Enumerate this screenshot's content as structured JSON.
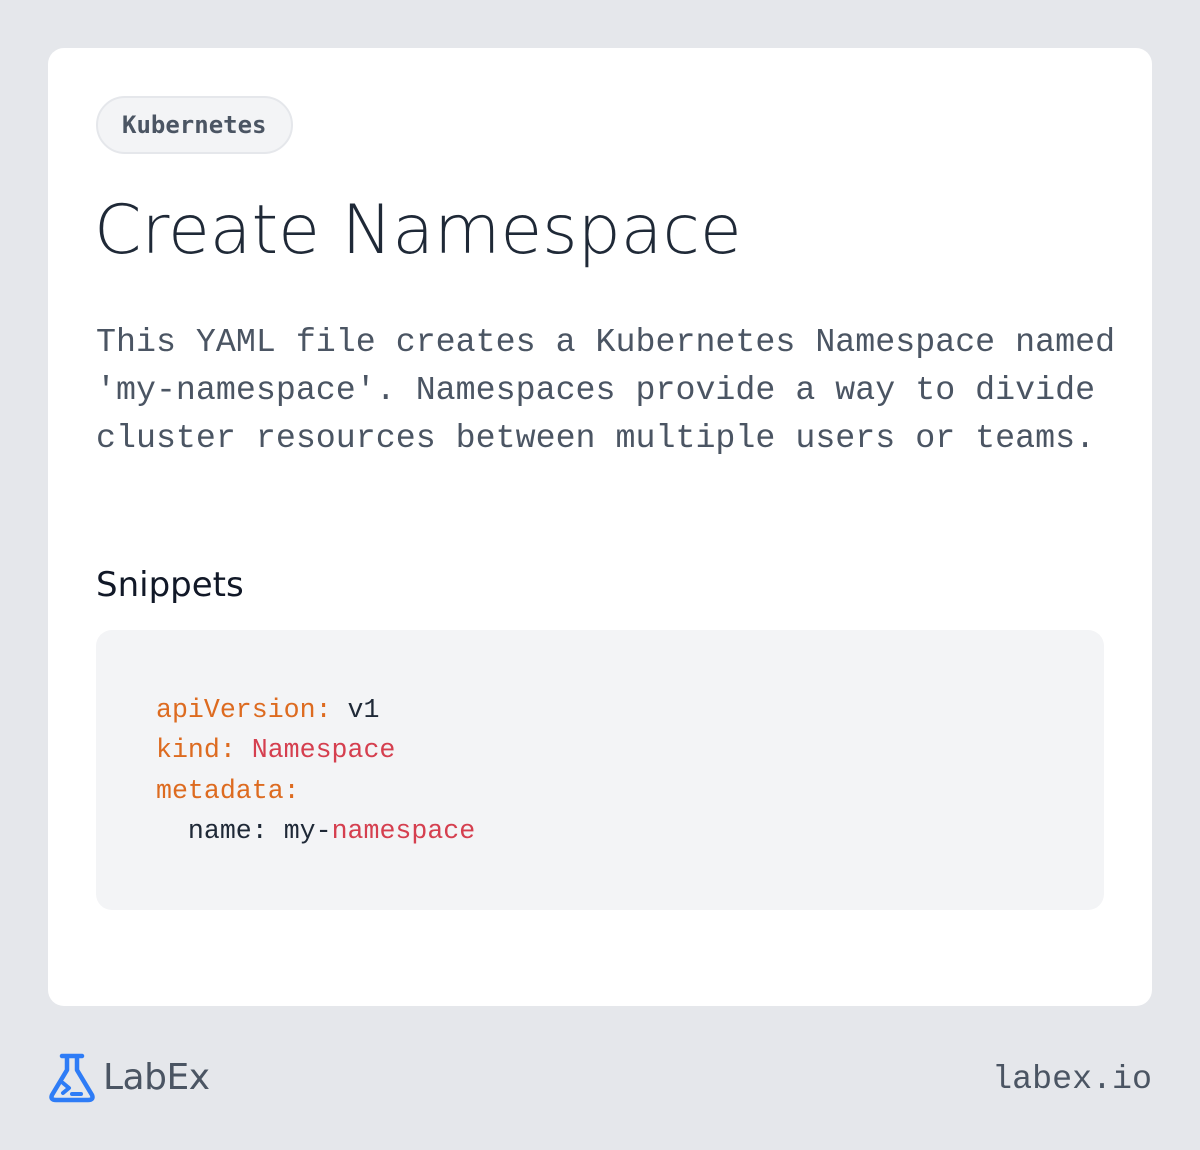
{
  "card": {
    "tag": "Kubernetes",
    "title": "Create Namespace",
    "description": "This YAML file creates a Kubernetes Namespace named 'my-namespace'. Namespaces provide a way to divide cluster resources between multiple users or teams.",
    "section_title": "Snippets"
  },
  "snippet": {
    "line1_key": "apiVersion:",
    "line1_value": "v1",
    "line2_key": "kind:",
    "line2_value": "Namespace",
    "line3_key": "metadata:",
    "line4_key": "name:",
    "line4_value_prefix": "my-",
    "line4_value_suffix": "namespace"
  },
  "footer": {
    "logo_text": "LabEx",
    "logo_icon": "flask-terminal-icon",
    "url": "labex.io"
  },
  "colors": {
    "background": "#e5e7eb",
    "card": "#ffffff",
    "code_background": "#f3f4f6",
    "yaml_key": "#dd6b20",
    "yaml_string": "#d53f4f",
    "brand_blue": "#2e7cf6"
  }
}
